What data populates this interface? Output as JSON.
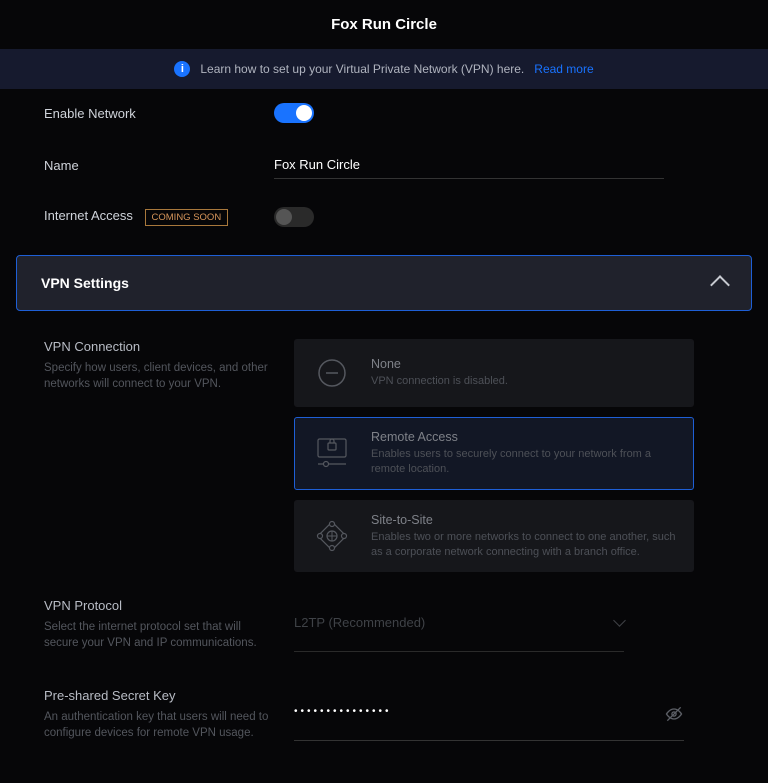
{
  "page_title": "Fox Run Circle",
  "banner": {
    "text": "Learn how to set up your Virtual Private Network (VPN) here.",
    "link_label": "Read more"
  },
  "fields": {
    "enable_network_label": "Enable Network",
    "name_label": "Name",
    "name_value": "Fox Run Circle",
    "internet_access_label": "Internet Access",
    "internet_access_badge": "COMING SOON"
  },
  "panel": {
    "title": "VPN Settings"
  },
  "vpn_connection": {
    "title": "VPN Connection",
    "desc": "Specify how users, client devices, and other networks will connect to your VPN.",
    "options": [
      {
        "title": "None",
        "desc": "VPN connection is disabled."
      },
      {
        "title": "Remote Access",
        "desc": "Enables users to securely connect to your network from a remote location."
      },
      {
        "title": "Site-to-Site",
        "desc": "Enables two or more networks to connect to one another, such as a corporate network connecting with a branch office."
      }
    ]
  },
  "vpn_protocol": {
    "title": "VPN Protocol",
    "desc": "Select the internet protocol set that will secure your VPN and IP communications.",
    "value": "L2TP (Recommended)"
  },
  "secret": {
    "title": "Pre-shared Secret Key",
    "desc": "An authentication key that users will need to configure devices for remote VPN usage.",
    "masked": "•••••••••••••••"
  }
}
